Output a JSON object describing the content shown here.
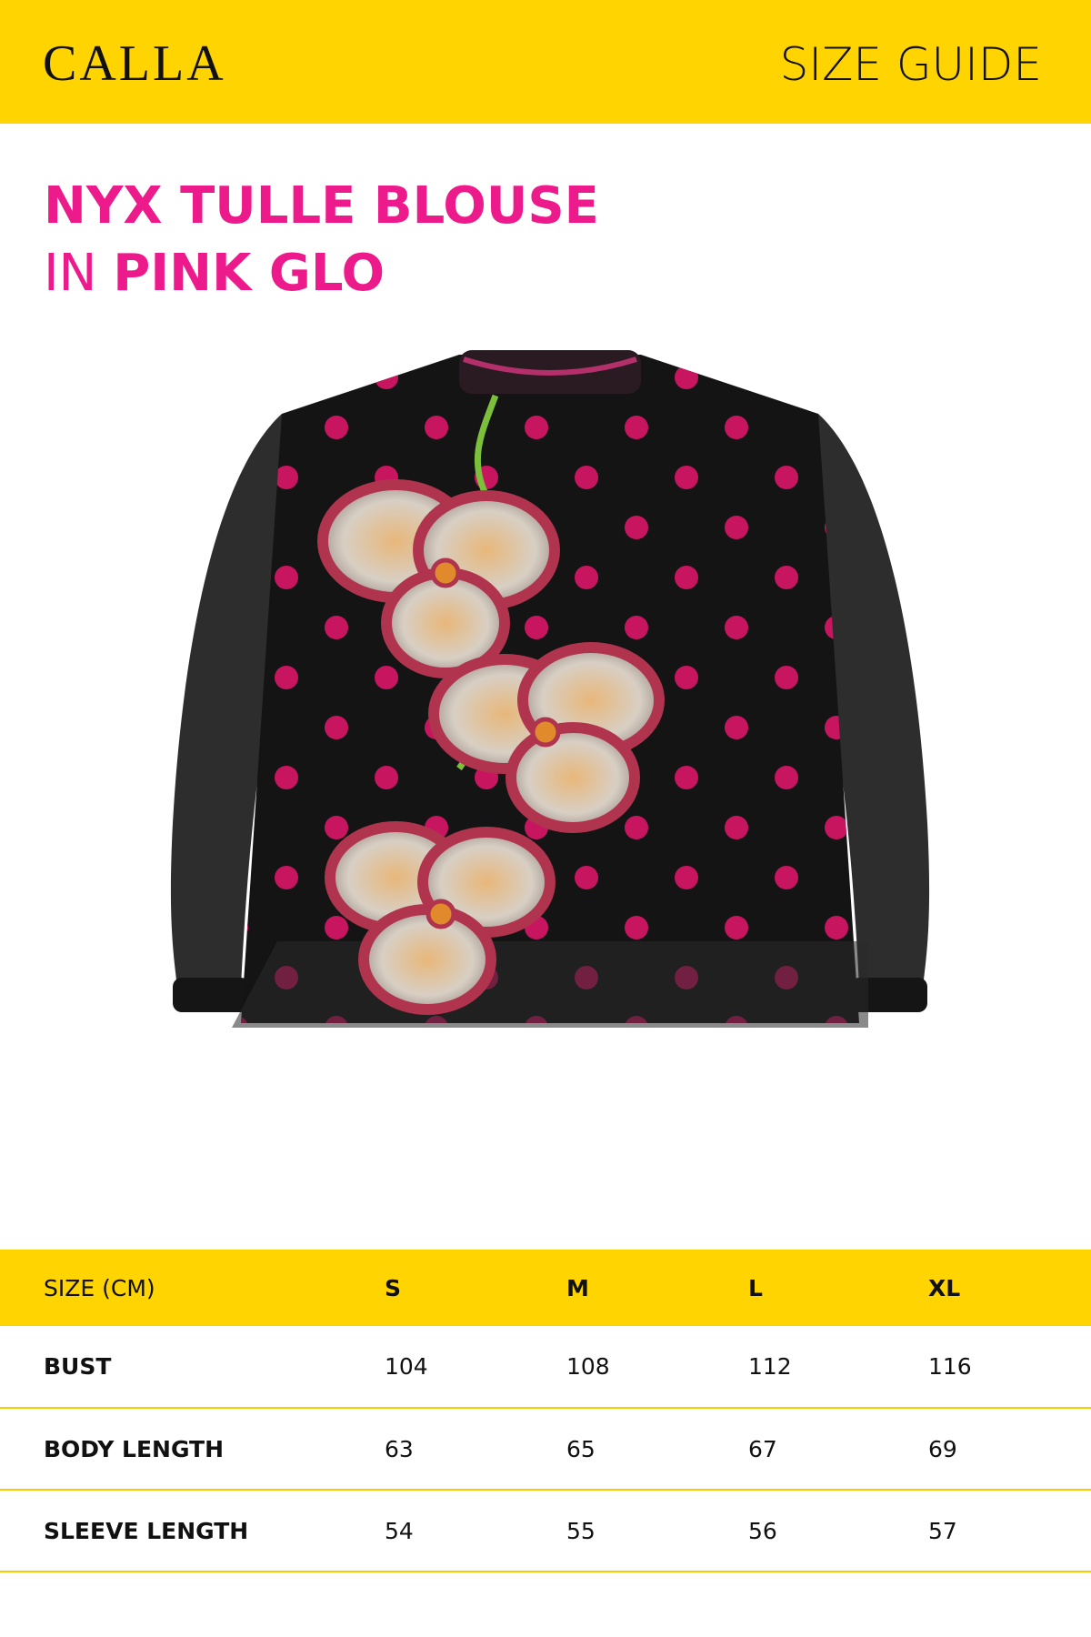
{
  "header": {
    "brand": "CALLA",
    "title": "SIZE GUIDE"
  },
  "product": {
    "name": "NYX TULLE BLOUSE",
    "in": "IN",
    "color": "PINK GLO"
  },
  "colors": {
    "accent_yellow": "#FFD400",
    "title_pink": "#EC1A8A"
  },
  "table": {
    "header": [
      "SIZE (CM)",
      "S",
      "M",
      "L",
      "XL"
    ],
    "rows": [
      {
        "label": "BUST",
        "values": [
          "104",
          "108",
          "112",
          "116"
        ]
      },
      {
        "label": "BODY LENGTH",
        "values": [
          "63",
          "65",
          "67",
          "69"
        ]
      },
      {
        "label": "SLEEVE LENGTH",
        "values": [
          "54",
          "55",
          "56",
          "57"
        ]
      }
    ]
  }
}
